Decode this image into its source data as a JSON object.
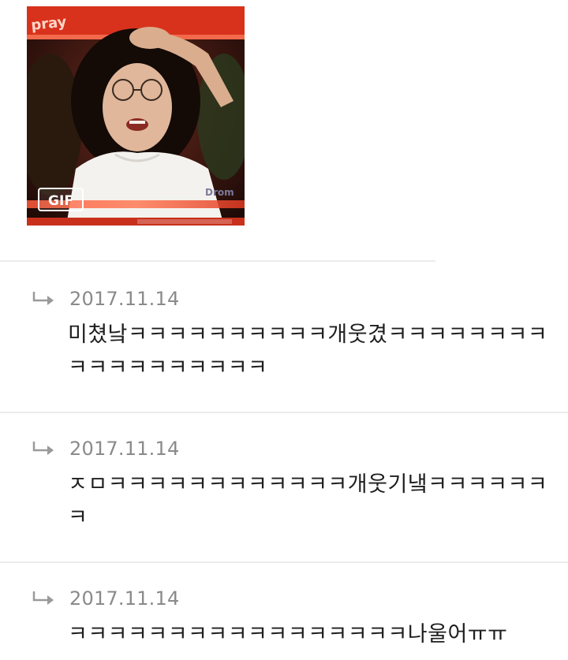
{
  "post": {
    "image_badge": "GIF"
  },
  "replies": [
    {
      "date": "2017.11.14",
      "text": "미쳤낰ㅋㅋㅋㅋㅋㅋㅋㅋㅋㅋ개웃겼ㅋㅋㅋㅋㅋㅋㅋㅋㅋㅋㅋㅋㅋㅋㅋㅋㅋㅋ"
    },
    {
      "date": "2017.11.14",
      "text": "ㅈㅁㅋㅋㅋㅋㅋㅋㅋㅋㅋㅋㅋㅋ개웃기냌ㅋㅋㅋㅋㅋㅋㅋ"
    },
    {
      "date": "2017.11.14",
      "text": "ㅋㅋㅋㅋㅋㅋㅋㅋㅋㅋㅋㅋㅋㅋㅋㅋㅋ나울어ㅠㅠ"
    }
  ],
  "icons": {
    "reply": "reply-arrow-icon"
  },
  "colors": {
    "date": "#8a8a8a",
    "divider": "#ececec",
    "text": "#1e1e1e",
    "frame_red": "#e8402a"
  }
}
